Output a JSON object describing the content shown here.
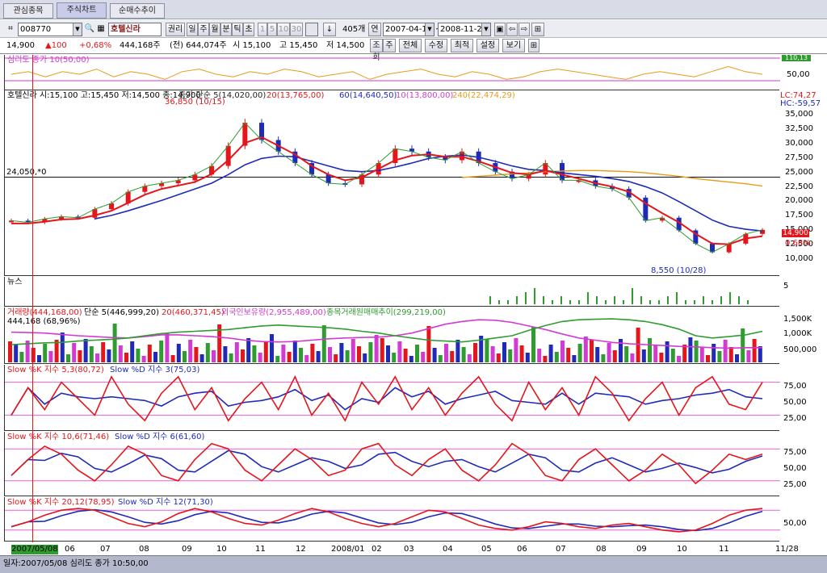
{
  "tabs": [
    "관심종목",
    "주식차트",
    "순매수추이"
  ],
  "active_tab": 1,
  "toolbar": {
    "code": "008770",
    "name": "호텔신라",
    "adjust": "권리",
    "periods": [
      "일",
      "주",
      "월",
      "분",
      "틱",
      "초"
    ],
    "intervals": [
      "1",
      "5",
      "10",
      "30"
    ],
    "count": "405개",
    "kind": "연",
    "start_date": "2007-04-16",
    "end_date": "2008-11-29",
    "buttons": [
      "조회",
      "주",
      "전체",
      "수정",
      "최적",
      "설정",
      "보기"
    ]
  },
  "quote": {
    "price": "14,900",
    "change": "▲100",
    "pct": "+0,68%",
    "volume": "444,168주",
    "prev": "(전) 644,074주",
    "open": "시 15,100",
    "high": "고 15,450",
    "low": "저 14,500"
  },
  "colors": {
    "red": "#e4161b",
    "blue": "#1f2bb8",
    "orange": "#e89a1a",
    "magenta": "#d23ad2",
    "green": "#2f9c2f",
    "pink": "#e95fe0"
  },
  "chart_data": [
    {
      "type": "line",
      "title": "심리도 종가 10(50,00)",
      "ylim": [
        0,
        100
      ],
      "yticks": [
        "50,00"
      ],
      "tag": "110,13",
      "series": [
        {
          "name": "심리도 종가 10",
          "values": [
            50,
            60,
            40,
            60,
            50,
            70,
            40,
            60,
            50,
            30,
            60,
            70,
            50,
            40,
            60,
            50,
            70,
            60,
            40,
            50,
            60,
            30,
            50,
            60,
            70,
            50,
            40,
            60,
            50,
            30,
            40,
            60,
            70,
            60,
            50,
            40,
            30,
            50,
            60,
            50,
            40,
            60,
            80,
            60,
            50
          ]
        }
      ]
    },
    {
      "type": "line",
      "title": "호텔신라 시:15,100 고:15,450 저:14,500 종:14,900",
      "ylim": [
        8000,
        38000
      ],
      "yticks": [
        "35,000",
        "32,500",
        "30,000",
        "27,500",
        "25,000",
        "22,500",
        "20,000",
        "17,500",
        "15,000",
        "12,500",
        "10,000"
      ],
      "legend": [
        "종가 단순 5(14,020,00)",
        "20(13,765,00)",
        "60(14,640,50)",
        "10(13,800,00)",
        "240(22,474,29)"
      ],
      "annotations": {
        "high": "36,850 (10/15)",
        "low": "8,550 (10/28)",
        "hline": "24,050,*0",
        "lc": "LC:74,27",
        "hc": "HC:-59,57",
        "last_price": "14,900",
        "last_pct": "0,68%"
      },
      "series": [
        {
          "name": "종가",
          "values": [
            16500,
            16200,
            16800,
            17200,
            17000,
            18500,
            19500,
            21500,
            22500,
            23000,
            23500,
            24500,
            26000,
            29500,
            33500,
            30500,
            28500,
            26500,
            24500,
            23000,
            22800,
            24500,
            26500,
            29000,
            28500,
            27500,
            27000,
            28500,
            26500,
            25000,
            23800,
            24500,
            26500,
            23500,
            23500,
            22500,
            22000,
            20500,
            16500,
            17000,
            14800,
            12500,
            11000,
            12500,
            14200,
            14900
          ]
        },
        {
          "name": "20",
          "values": [
            16000,
            16000,
            16300,
            16700,
            16800,
            17400,
            18200,
            19600,
            21000,
            22000,
            22600,
            23200,
            24600,
            27000,
            30000,
            31000,
            29500,
            28000,
            26000,
            24500,
            23500,
            24000,
            25500,
            27000,
            27800,
            28000,
            27600,
            27600,
            26800,
            25800,
            24800,
            24500,
            25200,
            24500,
            23800,
            23000,
            22400,
            21500,
            19500,
            17800,
            16200,
            14200,
            12500,
            12400,
            13400,
            13800
          ]
        },
        {
          "name": "60",
          "values": [
            null,
            null,
            null,
            null,
            null,
            16800,
            17400,
            18200,
            19100,
            20000,
            21000,
            22000,
            23000,
            24500,
            26200,
            27300,
            27700,
            27600,
            26800,
            26000,
            25200,
            25000,
            25200,
            25800,
            26500,
            27300,
            27700,
            27900,
            27500,
            26800,
            26000,
            25400,
            25200,
            24800,
            24500,
            24200,
            23800,
            23300,
            22400,
            21300,
            19800,
            18200,
            16600,
            15500,
            15000,
            14700
          ]
        },
        {
          "name": "240",
          "values": [
            null,
            null,
            null,
            null,
            null,
            null,
            null,
            null,
            null,
            null,
            null,
            null,
            null,
            null,
            null,
            null,
            null,
            null,
            null,
            null,
            null,
            null,
            null,
            null,
            null,
            null,
            null,
            24000,
            24200,
            24400,
            24600,
            24800,
            25000,
            25100,
            25200,
            25200,
            25100,
            25000,
            24800,
            24500,
            24200,
            23800,
            23500,
            23200,
            22900,
            22500
          ]
        }
      ]
    },
    {
      "type": "bar",
      "title": "뉴스",
      "yticks": [
        "5"
      ],
      "values": [
        2,
        1,
        1,
        2,
        3,
        4,
        2,
        1,
        2,
        1,
        1,
        3,
        2,
        1,
        2,
        1,
        4,
        2,
        1,
        1,
        2,
        3,
        1,
        1,
        2,
        1,
        2,
        3,
        2,
        1
      ]
    },
    {
      "type": "bar",
      "title": "거래량(444,168,00)",
      "subtitle": "444,168 (68,96%)",
      "legend": [
        "단순 5(446,999,20)",
        "20(460,371,45)",
        "외국인보유량(2,955,489,00)",
        "종목거래원매매추이(299,219,00)"
      ],
      "yticks": [
        "1,500K",
        "1,000K",
        "500,000"
      ],
      "series": [
        {
          "name": "외국인보유량",
          "values": [
            0.68,
            0.67,
            0.66,
            0.63,
            0.6,
            0.58,
            0.56,
            0.55,
            0.58,
            0.62,
            0.62,
            0.6,
            0.58,
            0.55,
            0.5,
            0.47,
            0.46,
            0.47,
            0.5,
            0.53,
            0.55,
            0.56,
            0.57,
            0.6,
            0.66,
            0.76,
            0.86,
            0.92,
            0.96,
            0.95,
            0.9,
            0.82,
            0.74,
            0.64,
            0.55,
            0.5,
            0.45,
            0.42,
            0.4,
            0.38,
            0.36,
            0.35,
            0.33,
            0.32,
            0.33,
            0.33
          ]
        },
        {
          "name": "종목거래원매매추이",
          "values": [
            0.4,
            0.42,
            0.44,
            0.45,
            0.48,
            0.5,
            0.52,
            0.55,
            0.6,
            0.65,
            0.68,
            0.7,
            0.72,
            0.74,
            0.78,
            0.82,
            0.84,
            0.82,
            0.8,
            0.78,
            0.75,
            0.7,
            0.66,
            0.6,
            0.55,
            0.5,
            0.48,
            0.46,
            0.5,
            0.55,
            0.6,
            0.72,
            0.83,
            0.92,
            0.96,
            0.97,
            0.98,
            0.96,
            0.92,
            0.85,
            0.75,
            0.6,
            0.55,
            0.58,
            0.62,
            0.7
          ]
        }
      ]
    },
    {
      "type": "line",
      "title": "Slow %K 지수 5,3(80,72)",
      "title2": "Slow %D 지수 3(75,03)",
      "ylim": [
        0,
        100
      ],
      "yticks": [
        "75,00",
        "50,00",
        "25,00"
      ],
      "series": [
        {
          "name": "Slow %K",
          "values": [
            20,
            70,
            30,
            80,
            50,
            20,
            90,
            40,
            10,
            60,
            90,
            30,
            70,
            10,
            50,
            80,
            30,
            90,
            20,
            60,
            10,
            80,
            40,
            90,
            30,
            70,
            20,
            60,
            90,
            40,
            10,
            80,
            30,
            70,
            20,
            90,
            60,
            10,
            50,
            80,
            20,
            70,
            90,
            40,
            30,
            80
          ]
        }
      ]
    },
    {
      "type": "line",
      "title": "Slow %K 지수 10,6(71,46)",
      "title2": "Slow %D 지수 6(61,60)",
      "ylim": [
        0,
        100
      ],
      "yticks": [
        "75,00",
        "50,00",
        "25,00"
      ],
      "series": [
        {
          "name": "Slow %K",
          "values": [
            30,
            60,
            85,
            70,
            40,
            20,
            50,
            85,
            70,
            30,
            20,
            60,
            90,
            80,
            40,
            20,
            50,
            80,
            60,
            30,
            40,
            80,
            90,
            50,
            30,
            60,
            80,
            40,
            20,
            50,
            90,
            70,
            30,
            20,
            60,
            80,
            50,
            20,
            40,
            70,
            50,
            15,
            40,
            70,
            60,
            70
          ]
        }
      ]
    },
    {
      "type": "line",
      "title": "Slow %K 지수 20,12(78,95)",
      "title2": "Slow %D 지수 12(71,30)",
      "ylim": [
        0,
        100
      ],
      "yticks": [
        "50,00"
      ],
      "series": [
        {
          "name": "Slow %K",
          "values": [
            30,
            45,
            65,
            80,
            85,
            80,
            60,
            40,
            30,
            45,
            70,
            85,
            75,
            55,
            40,
            35,
            50,
            70,
            85,
            75,
            55,
            40,
            30,
            40,
            60,
            80,
            75,
            55,
            35,
            25,
            20,
            30,
            45,
            40,
            30,
            25,
            35,
            40,
            30,
            20,
            15,
            20,
            40,
            65,
            80,
            85
          ]
        }
      ]
    }
  ],
  "xaxis": {
    "labels": [
      "2007/05/08",
      "06",
      "07",
      "08",
      "09",
      "10",
      "11",
      "12",
      "2008/01",
      "02",
      "03",
      "04",
      "05",
      "06",
      "07",
      "08",
      "09",
      "10",
      "11",
      "11/28"
    ]
  },
  "footer": {
    "text": "일자:2007/05/08 심리도 종가 10:50,00"
  }
}
